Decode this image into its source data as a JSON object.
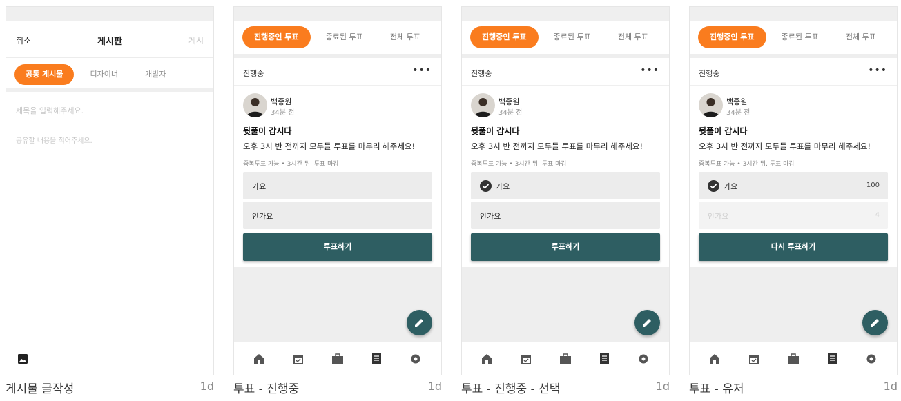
{
  "colors": {
    "accent": "#fa7c1e",
    "primary": "#2e5e62",
    "background": "#eeeeee"
  },
  "frames": [
    {
      "caption": "게시물 글작성",
      "age": "1d",
      "header": {
        "cancel": "취소",
        "title": "게시판",
        "post": "게시"
      },
      "tabs": [
        "공통 게시물",
        "디자이너",
        "개발자"
      ],
      "title_placeholder": "제목을 입력해주세요.",
      "body_placeholder": "공유할 내용을 적어주세요.",
      "bottom_icon": "image-icon"
    },
    {
      "caption": "투표 - 진행중",
      "age": "1d",
      "tabs": [
        "진행중인 투표",
        "종료된 투표",
        "전체 투표"
      ],
      "status": "진행중",
      "more": "•••",
      "author": "백종원",
      "time": "34분 전",
      "post_title": "뒷풀이 갑시다",
      "post_body": "오후 3시 반 전까지 모두들 투표를 마무리 해주세요!",
      "meta": "중복투표 가능 • 3시간 뒤, 투표 마감",
      "options": [
        {
          "label": "가요"
        },
        {
          "label": "안가요"
        }
      ],
      "button": "투표하기"
    },
    {
      "caption": "투표 - 진행중 - 선택",
      "age": "1d",
      "tabs": [
        "진행중인 투표",
        "종료된 투표",
        "전체 투표"
      ],
      "status": "진행중",
      "more": "•••",
      "author": "백종원",
      "time": "34분 전",
      "post_title": "뒷풀이 갑시다",
      "post_body": "오후 3시 반 전까지 모두들 투표를 마무리 해주세요!",
      "meta": "중복투표 가능 • 3시간 뒤, 투표 마감",
      "options": [
        {
          "label": "가요",
          "checked": true
        },
        {
          "label": "안가요"
        }
      ],
      "button": "투표하기"
    },
    {
      "caption": "투표 - 유저",
      "age": "1d",
      "tabs": [
        "진행중인 투표",
        "종료된 투표",
        "전체 투표"
      ],
      "status": "진행중",
      "more": "•••",
      "author": "백종원",
      "time": "34분 전",
      "post_title": "뒷풀이 갑시다",
      "post_body": "오후 3시 반 전까지 모두들 투표를 마무리 해주세요!",
      "meta": "중복투표 가능 • 3시간 뒤, 투표 마감",
      "options": [
        {
          "label": "가요",
          "checked": true,
          "count": "100"
        },
        {
          "label": "안가요",
          "count": "4"
        }
      ],
      "button": "다시 투표하기"
    }
  ],
  "nav_icons": [
    "home-icon",
    "calendar-icon",
    "briefcase-icon",
    "document-icon",
    "settings-icon"
  ],
  "fab_icon": "pencil-icon"
}
